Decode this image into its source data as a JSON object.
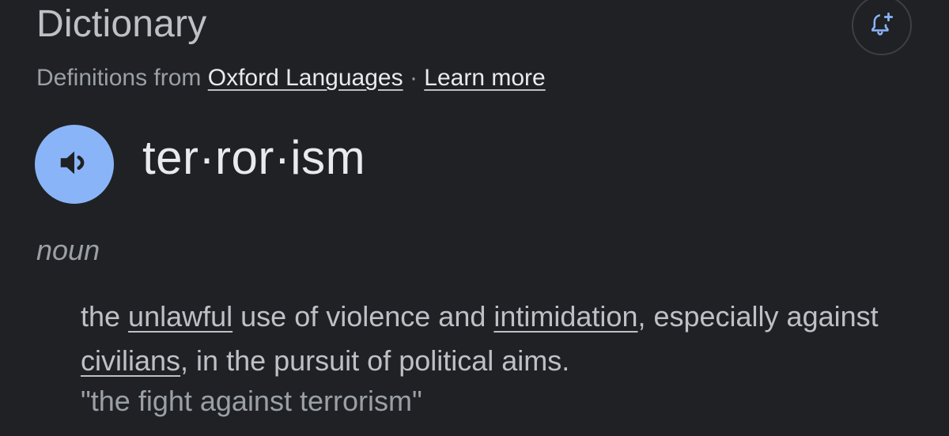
{
  "header": {
    "title": "Dictionary",
    "alert_icon": "bell-plus-icon"
  },
  "source": {
    "prefix": "Definitions from",
    "provider_link": "Oxford Languages",
    "separator": "·",
    "learn_more_link": "Learn more"
  },
  "entry": {
    "pronounce_icon": "speaker-icon",
    "headword": "ter·ror·ism",
    "part_of_speech": "noun",
    "definition": {
      "t1": "the ",
      "link1": "unlawful",
      "t2": " use of violence and ",
      "link2": "intimidation",
      "t3": ", especially against ",
      "link3": "civilians",
      "t4": ", in the pursuit of political aims."
    },
    "example": "\"the fight against terrorism\""
  },
  "colors": {
    "background": "#202124",
    "accent_blue": "#8ab4f8",
    "text_primary": "#e8eaed",
    "text_secondary": "#9aa0a6"
  }
}
